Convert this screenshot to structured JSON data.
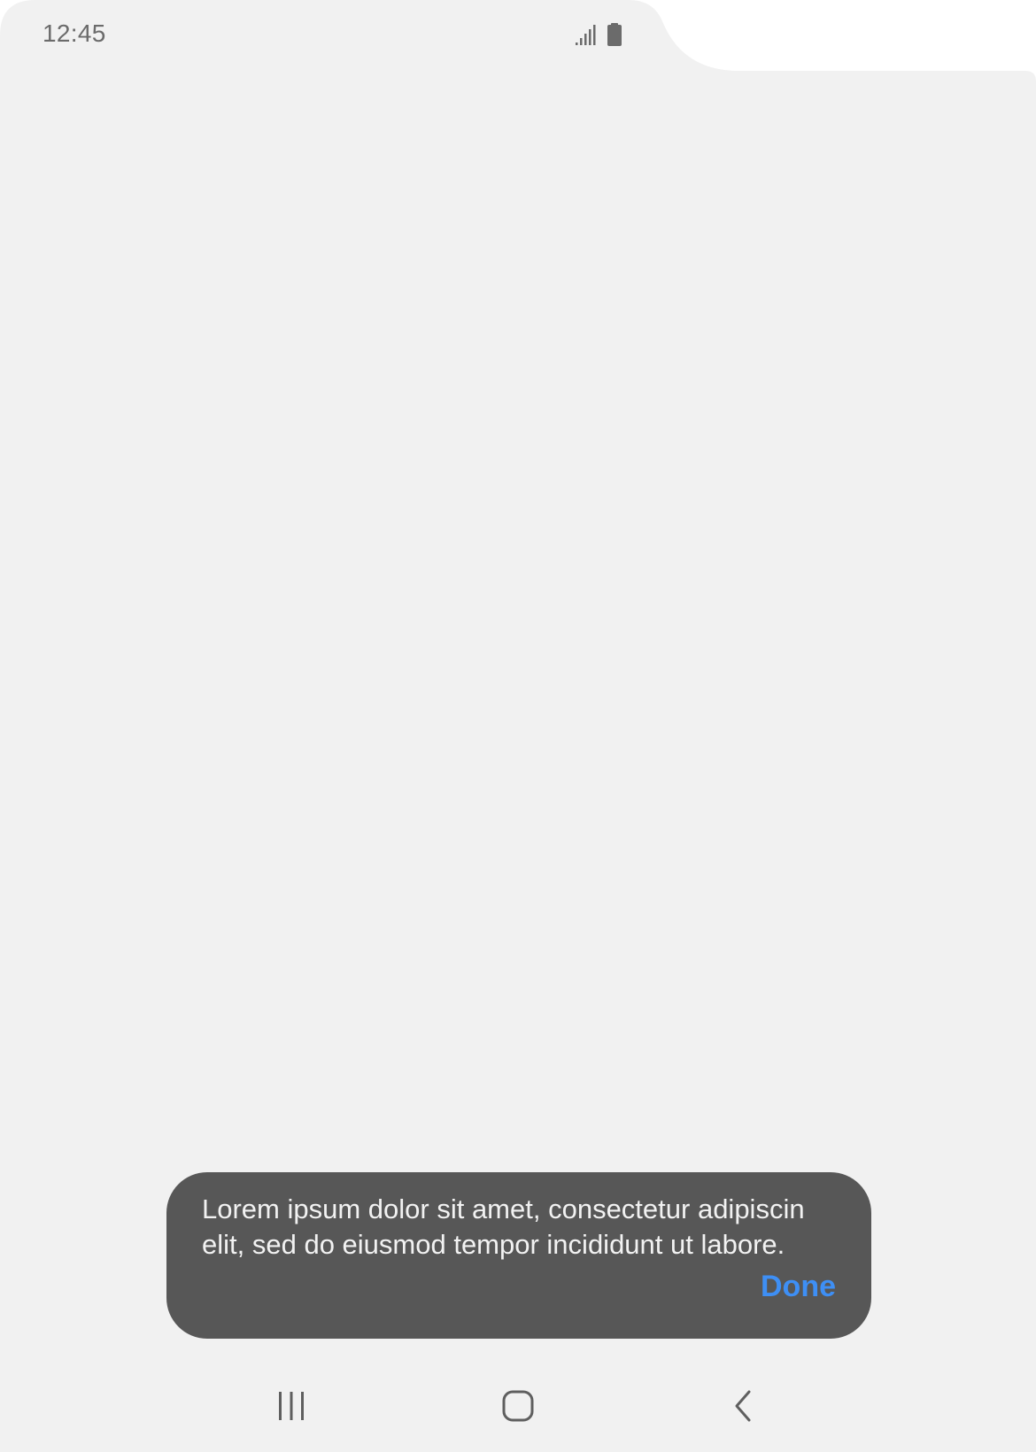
{
  "status_bar": {
    "time": "12:45",
    "icons": [
      "signal-icon",
      "battery-icon"
    ]
  },
  "snackbar": {
    "message": "Lorem ipsum dolor sit amet, consectetur adipiscin elit, sed do eiusmod tempor incididunt ut labore.",
    "action_label": "Done",
    "action_color": "#3e8ff5",
    "background_color": "#575757"
  },
  "navigation": {
    "buttons": [
      "recent-apps-icon",
      "home-icon",
      "back-icon"
    ]
  },
  "colors": {
    "screen_background": "#f1f1f1",
    "icon_gray": "#6b6b6b"
  }
}
